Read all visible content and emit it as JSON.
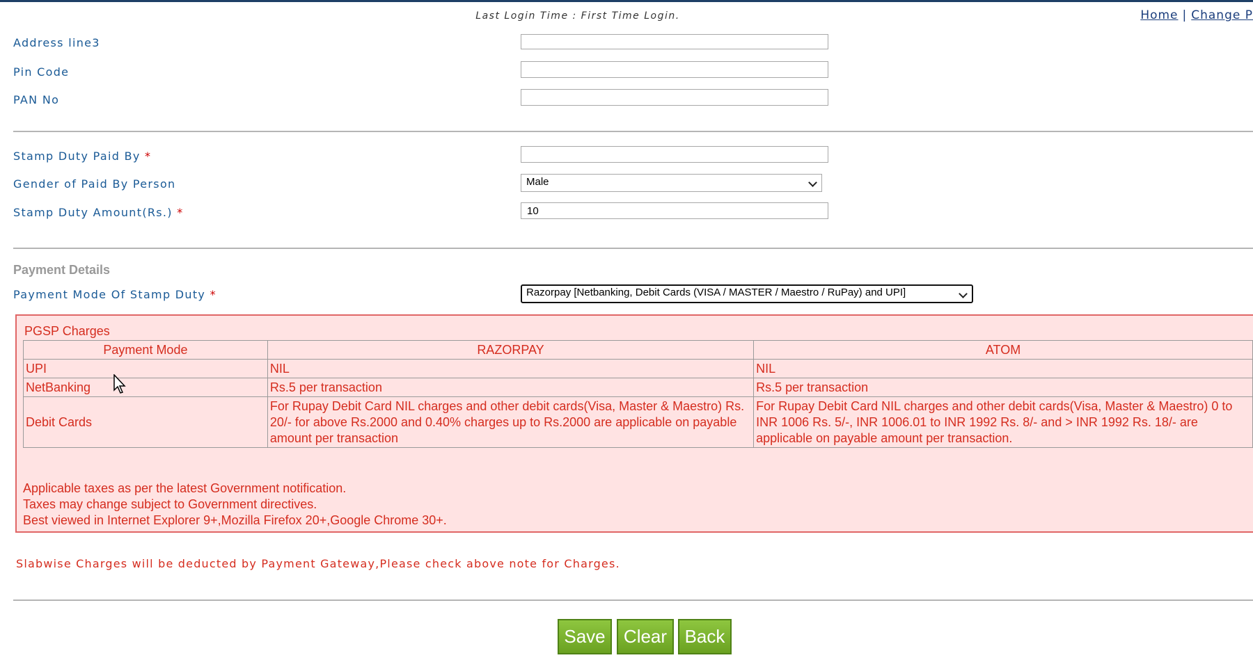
{
  "header": {
    "login_time": "Last Login Time : First Time Login.",
    "links": {
      "home": "Home",
      "separator": "|",
      "change": "Change P"
    }
  },
  "form": {
    "address_line3": {
      "label": "Address line3",
      "value": ""
    },
    "pin_code": {
      "label": "Pin Code",
      "value": ""
    },
    "pan_no": {
      "label": "PAN No",
      "value": ""
    },
    "stamp_duty_paid_by": {
      "label": "Stamp Duty Paid By",
      "required": "*",
      "value": ""
    },
    "gender": {
      "label": "Gender of Paid By Person",
      "selected": "Male"
    },
    "stamp_duty_amount": {
      "label": "Stamp Duty Amount(Rs.)",
      "required": "*",
      "value": "10"
    }
  },
  "payment": {
    "section_title": "Payment Details",
    "mode_label": "Payment Mode Of Stamp Duty",
    "required": "*",
    "mode_selected": "Razorpay [Netbanking, Debit Cards (VISA / MASTER / Maestro / RuPay) and UPI]"
  },
  "pgsp": {
    "title": "PGSP Charges",
    "headers": [
      "Payment Mode",
      "RAZORPAY",
      "ATOM"
    ],
    "rows": [
      [
        "UPI",
        "NIL",
        "NIL"
      ],
      [
        "NetBanking",
        "Rs.5 per transaction",
        "Rs.5 per transaction"
      ],
      [
        "Debit Cards",
        "For Rupay Debit Card NIL charges and other debit cards(Visa, Master & Maestro) Rs. 20/- for above Rs.2000 and 0.40% charges up to Rs.2000 are applicable on payable amount per transaction",
        "For Rupay Debit Card NIL charges and other debit cards(Visa, Master & Maestro) 0 to INR 1006 Rs. 5/-, INR 1006.01 to INR 1992 Rs. 8/- and > INR 1992 Rs. 18/- are applicable on payable amount per transaction."
      ]
    ],
    "notes": [
      "Applicable taxes as per the latest Government notification.",
      "Taxes may change subject to Government directives.",
      "Best viewed in Internet Explorer 9+,Mozilla Firefox 20+,Google Chrome 30+."
    ]
  },
  "slab_note": "Slabwise Charges will be deducted by Payment Gateway,Please check above note for Charges.",
  "buttons": {
    "save": "Save",
    "clear": "Clear",
    "back": "Back"
  },
  "colors": {
    "label_blue": "#1a5a96",
    "note_red": "#d52d1f",
    "panel_bg": "#ffe3e3",
    "button_green": "#7ab532"
  }
}
